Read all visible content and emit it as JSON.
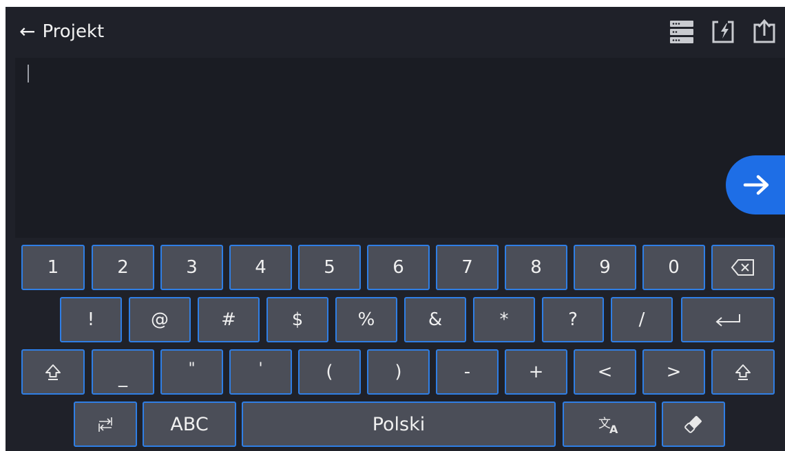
{
  "header": {
    "back_arrow": "←",
    "title": "Projekt",
    "icons": [
      "database-list-icon",
      "import-icon",
      "export-icon"
    ]
  },
  "input": {
    "value": ""
  },
  "keyboard": {
    "row1": [
      "1",
      "2",
      "3",
      "4",
      "5",
      "6",
      "7",
      "8",
      "9",
      "0"
    ],
    "row2": [
      "!",
      "@",
      "#",
      "$",
      "%",
      "&",
      "*",
      "?",
      "/"
    ],
    "row3": [
      "_",
      "\"",
      "'",
      "(",
      ")",
      "-",
      "+",
      "<",
      ">"
    ],
    "mode_label": "ABC",
    "language_label": "Polski",
    "icons": [
      "backspace-icon",
      "enter-icon",
      "shift-icon",
      "switch-keyboard-icon",
      "translate-icon",
      "eraser-icon",
      "confirm-arrow-icon"
    ]
  },
  "colors": {
    "background": "#1f2129",
    "key": "#4b4e58",
    "key_border": "#2f7fe6",
    "accent": "#1e6ee6"
  }
}
